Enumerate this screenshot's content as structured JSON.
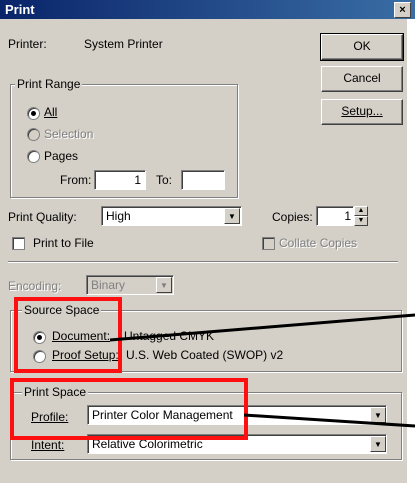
{
  "window": {
    "title": "Print",
    "close_glyph": "×"
  },
  "printer": {
    "label": "Printer:",
    "value": "System Printer"
  },
  "buttons": {
    "ok": "OK",
    "cancel": "Cancel",
    "setup": "Setup..."
  },
  "print_range": {
    "legend": "Print Range",
    "all": "All",
    "selection": "Selection",
    "pages": "Pages",
    "from_label": "From:",
    "from_value": "1",
    "to_label": "To:",
    "to_value": ""
  },
  "print_quality": {
    "label": "Print Quality:",
    "value": "High"
  },
  "copies": {
    "label": "Copies:",
    "value": "1"
  },
  "print_to_file": "Print to File",
  "collate_copies": "Collate Copies",
  "encoding": {
    "label": "Encoding:",
    "value": "Binary"
  },
  "source_space": {
    "legend": "Source Space",
    "document_label": "Document:",
    "document_value": "Untagged CMYK",
    "proof_label": "Proof Setup:",
    "proof_value": "U.S. Web Coated (SWOP) v2"
  },
  "print_space": {
    "legend": "Print Space",
    "profile_label": "Profile:",
    "profile_value": "Printer Color Management",
    "intent_label": "Intent:",
    "intent_value": "Relative Colorimetric"
  },
  "colors": {
    "highlight": "#ff1010",
    "titlebar": "#0a246a",
    "dialog": "#d4d0c8"
  },
  "icons": {
    "dropdown": "▼",
    "spin_up": "▲",
    "spin_down": "▼"
  }
}
